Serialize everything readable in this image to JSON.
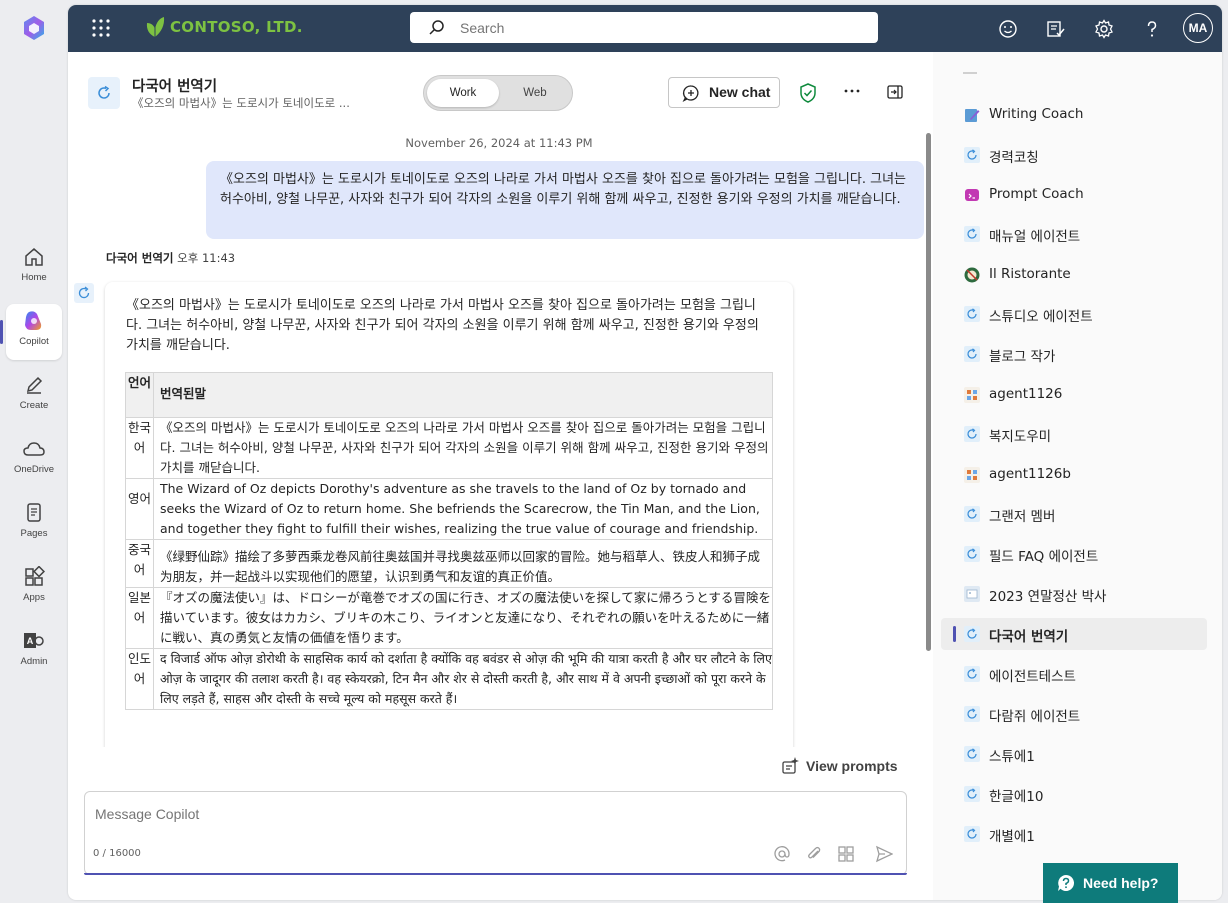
{
  "rail": {
    "items": [
      {
        "label": "Home"
      },
      {
        "label": "Copilot"
      },
      {
        "label": "Create"
      },
      {
        "label": "OneDrive"
      },
      {
        "label": "Pages"
      },
      {
        "label": "Apps"
      },
      {
        "label": "Admin"
      }
    ]
  },
  "topbar": {
    "brand": "CONTOSO, LTD.",
    "search_placeholder": "Search",
    "avatar_initials": "MA"
  },
  "header": {
    "agent_title": "다국어 번역기",
    "agent_subtitle": "《오즈의 마법사》는 도로시가 토네이도로 ...",
    "toggle_work": "Work",
    "toggle_web": "Web",
    "new_chat": "New chat"
  },
  "chat": {
    "timestamp": "November 26, 2024 at 11:43 PM",
    "user_message": "《오즈의 마법사》는 도로시가 토네이도로 오즈의 나라로 가서 마법사 오즈를 찾아 집으로 돌아가려는 모험을 그립니다. 그녀는 허수아비, 양철 나무꾼, 사자와 친구가 되어 각자의 소원을 이루기 위해 함께 싸우고, 진정한 용기와 우정의 가치를 깨닫습니다.",
    "bot_name": "다국어 번역기",
    "bot_time": "오후 11:43",
    "bot_intro": "《오즈의 마법사》는 도로시가 토네이도로 오즈의 나라로 가서 마법사 오즈를 찾아 집으로 돌아가려는 모험을 그립니다. 그녀는 허수아비, 양철 나무꾼, 사자와 친구가 되어 각자의 소원을 이루기 위해 함께 싸우고, 진정한 용기와 우정의 가치를 깨닫습니다.",
    "table": {
      "headers": [
        "언어",
        "번역된말"
      ],
      "rows": [
        {
          "lang": "한국어",
          "text": "《오즈의 마법사》는 도로시가 토네이도로 오즈의 나라로 가서 마법사 오즈를 찾아 집으로 돌아가려는 모험을 그립니다. 그녀는 허수아비, 양철 나무꾼, 사자와 친구가 되어 각자의 소원을 이루기 위해 함께 싸우고, 진정한 용기와 우정의 가치를 깨닫습니다."
        },
        {
          "lang": "영어",
          "text": "The Wizard of Oz depicts Dorothy's adventure as she travels to the land of Oz by tornado and seeks the Wizard of Oz to return home. She befriends the Scarecrow, the Tin Man, and the Lion, and together they fight to fulfill their wishes, realizing the true value of courage and friendship."
        },
        {
          "lang": "중국어",
          "text": "《绿野仙踪》描绘了多萝西乘龙卷风前往奥兹国并寻找奥兹巫师以回家的冒险。她与稻草人、铁皮人和狮子成为朋友，并一起战斗以实现他们的愿望，认识到勇气和友谊的真正价值。"
        },
        {
          "lang": "일본어",
          "text": "『オズの魔法使い』は、ドロシーが竜巻でオズの国に行き、オズの魔法使いを探して家に帰ろうとする冒険を描いています。彼女はカカシ、ブリキの木こり、ライオンと友達になり、それぞれの願いを叶えるために一緒に戦い、真の勇気と友情の価値を悟ります。"
        },
        {
          "lang": "인도어",
          "text": "द विजार्ड ऑफ ओज़ डोरोथी के साहसिक कार्य को दर्शाता है क्योंकि वह बवंडर से ओज़ की भूमि की यात्रा करती है और घर लौटने के लिए ओज़ के जादूगर की तलाश करती है। वह स्केयरक्रो, टिन मैन और शेर से दोस्ती करती है, और साथ में वे अपनी इच्छाओं को पूरा करने के लिए लड़ते हैं, साहस और दोस्ती के सच्चे मूल्य को महसूस करते हैं।"
        }
      ]
    }
  },
  "composer": {
    "view_prompts": "View prompts",
    "placeholder": "Message Copilot",
    "counter": "0 / 16000"
  },
  "agents": [
    {
      "label": "Writing Coach",
      "icon": "writing-coach-icon"
    },
    {
      "label": "경력코칭",
      "icon": "agent-icon"
    },
    {
      "label": "Prompt Coach",
      "icon": "prompt-coach-icon"
    },
    {
      "label": "매뉴얼 에이전트",
      "icon": "agent-icon"
    },
    {
      "label": "Il Ristorante",
      "icon": "ristorante-icon"
    },
    {
      "label": "스튜디오 에이전트",
      "icon": "agent-icon"
    },
    {
      "label": "블로그 작가",
      "icon": "agent-icon"
    },
    {
      "label": "agent1126",
      "icon": "grid-agent-icon"
    },
    {
      "label": "복지도우미",
      "icon": "agent-icon"
    },
    {
      "label": "agent1126b",
      "icon": "grid-agent-icon"
    },
    {
      "label": "그랜저 멤버",
      "icon": "agent-icon"
    },
    {
      "label": "필드 FAQ 에이전트",
      "icon": "agent-icon"
    },
    {
      "label": "2023 연말정산 박사",
      "icon": "image-agent-icon"
    },
    {
      "label": "다국어 번역기",
      "icon": "agent-icon",
      "selected": true
    },
    {
      "label": "에이전트테스트",
      "icon": "agent-icon"
    },
    {
      "label": "다람쥐 에이전트",
      "icon": "agent-icon"
    },
    {
      "label": "스튜에1",
      "icon": "agent-icon"
    },
    {
      "label": "한글에10",
      "icon": "agent-icon"
    },
    {
      "label": "개별에1",
      "icon": "agent-icon"
    }
  ],
  "help": {
    "label": "Need help?"
  },
  "colors": {
    "topbar": "#2e4159",
    "accent": "#4f52b2",
    "brand_green": "#7dc242",
    "user_bubble": "#e0e7fb",
    "help_button": "#0e7b7b"
  }
}
